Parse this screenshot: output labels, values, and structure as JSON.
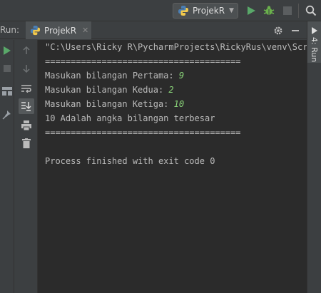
{
  "toolbar": {
    "run_config": "ProjekR"
  },
  "run_panel": {
    "label": "Run:",
    "tab_label": "ProjekR",
    "side_tab": "4: Run"
  },
  "console": {
    "cmd_line": "\"C:\\Users\\Ricky R\\PycharmProjects\\RickyRus\\venv\\Scrip",
    "separator": "======================================",
    "prompt1": "Masukan bilangan Pertama: ",
    "value1": "9",
    "prompt2": "Masukan bilangan Kedua: ",
    "value2": "2",
    "prompt3": "Masukan bilangan Ketiga: ",
    "value3": "10",
    "result": "10 Adalah angka bilangan terbesar",
    "exit": "Process finished with exit code 0"
  },
  "colors": {
    "console_bg": "#2b2b2b",
    "input_value": "#8bd67a",
    "run_green": "#59a869",
    "debug_green": "#6ab04c"
  }
}
